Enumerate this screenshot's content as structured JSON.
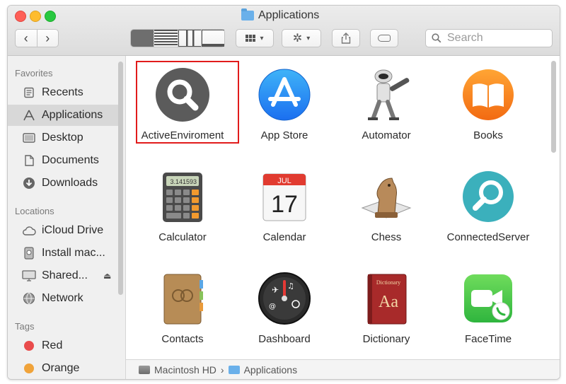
{
  "window": {
    "title": "Applications"
  },
  "toolbar": {
    "back": "‹",
    "forward": "›",
    "search_placeholder": "Search"
  },
  "sidebar": {
    "favorites_header": "Favorites",
    "favorites": [
      {
        "label": "Recents",
        "icon": "recents-icon"
      },
      {
        "label": "Applications",
        "icon": "applications-icon"
      },
      {
        "label": "Desktop",
        "icon": "desktop-icon"
      },
      {
        "label": "Documents",
        "icon": "documents-icon"
      },
      {
        "label": "Downloads",
        "icon": "downloads-icon"
      }
    ],
    "locations_header": "Locations",
    "locations": [
      {
        "label": "iCloud Drive",
        "icon": "cloud-icon"
      },
      {
        "label": "Install mac...",
        "icon": "disk-icon"
      },
      {
        "label": "Shared...",
        "icon": "display-icon"
      },
      {
        "label": "Network",
        "icon": "globe-icon"
      }
    ],
    "tags_header": "Tags",
    "tags": [
      {
        "label": "Red",
        "color": "#e94b4b"
      },
      {
        "label": "Orange",
        "color": "#f0a33a"
      }
    ]
  },
  "apps": [
    {
      "label": "ActiveEnviroment",
      "icon": "magnifier-dark-icon",
      "selected": true
    },
    {
      "label": "App Store",
      "icon": "app-store-icon"
    },
    {
      "label": "Automator",
      "icon": "automator-robot-icon"
    },
    {
      "label": "Books",
      "icon": "books-icon"
    },
    {
      "label": "Calculator",
      "icon": "calculator-icon"
    },
    {
      "label": "Calendar",
      "icon": "calendar-icon"
    },
    {
      "label": "Chess",
      "icon": "chess-knight-icon"
    },
    {
      "label": "ConnectedServer",
      "icon": "magnifier-teal-icon"
    },
    {
      "label": "Contacts",
      "icon": "contacts-icon"
    },
    {
      "label": "Dashboard",
      "icon": "dashboard-icon"
    },
    {
      "label": "Dictionary",
      "icon": "dictionary-icon"
    },
    {
      "label": "FaceTime",
      "icon": "facetime-icon"
    }
  ],
  "calendar_icon": {
    "month": "JUL",
    "day": "17"
  },
  "calculator_icon": {
    "display": "3.141593"
  },
  "dictionary_icon": {
    "title": "Dictionary",
    "glyph": "Aa"
  },
  "pathbar": {
    "disk": "Macintosh HD",
    "separator": "›",
    "folder": "Applications"
  },
  "colors": {
    "selection_outline": "#e11b1b",
    "sidebar_selected": "#d8d8d8",
    "folder_blue": "#6ab0ea"
  }
}
